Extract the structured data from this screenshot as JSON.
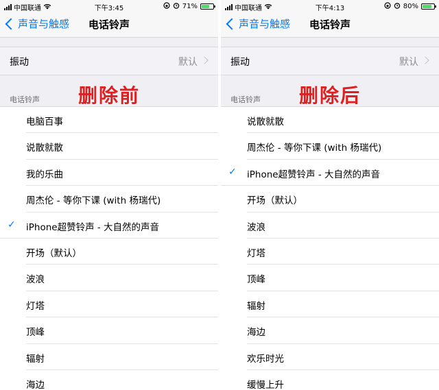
{
  "colors": {
    "accent": "#007aff",
    "overlay_red": "#e02020",
    "battery_green": "#4cd964"
  },
  "panels": [
    {
      "status": {
        "carrier": "中国联通",
        "time": "下午3:45",
        "battery": "71%",
        "battery_level": 0.71
      },
      "nav": {
        "back_label": "声音与触感",
        "title": "电话铃声"
      },
      "vibration": {
        "label": "振动",
        "value": "默认"
      },
      "section_header": "电话铃声",
      "caption": "删除前",
      "items": [
        {
          "label": "电脑百事",
          "selected": false
        },
        {
          "label": "说散就散",
          "selected": false
        },
        {
          "label": "我的乐曲",
          "selected": false
        },
        {
          "label": "周杰伦 - 等你下课 (with 杨瑞代)",
          "selected": false
        },
        {
          "label": "iPhone超赞铃声 - 大自然的声音",
          "selected": true
        },
        {
          "label": "开场（默认）",
          "selected": false
        },
        {
          "label": "波浪",
          "selected": false
        },
        {
          "label": "灯塔",
          "selected": false
        },
        {
          "label": "顶峰",
          "selected": false
        },
        {
          "label": "辐射",
          "selected": false
        },
        {
          "label": "海边",
          "selected": false
        }
      ]
    },
    {
      "status": {
        "carrier": "中国联通",
        "time": "下午4:13",
        "battery": "80%",
        "battery_level": 0.8
      },
      "nav": {
        "back_label": "声音与触感",
        "title": "电话铃声"
      },
      "vibration": {
        "label": "振动",
        "value": "默认"
      },
      "section_header": "电话铃声",
      "caption": "删除后",
      "items": [
        {
          "label": "说散就散",
          "selected": false
        },
        {
          "label": "周杰伦 - 等你下课 (with 杨瑞代)",
          "selected": false
        },
        {
          "label": "iPhone超赞铃声 - 大自然的声音",
          "selected": true
        },
        {
          "label": "开场（默认）",
          "selected": false
        },
        {
          "label": "波浪",
          "selected": false
        },
        {
          "label": "灯塔",
          "selected": false
        },
        {
          "label": "顶峰",
          "selected": false
        },
        {
          "label": "辐射",
          "selected": false
        },
        {
          "label": "海边",
          "selected": false
        },
        {
          "label": "欢乐时光",
          "selected": false
        },
        {
          "label": "缓慢上升",
          "selected": false
        }
      ]
    }
  ]
}
